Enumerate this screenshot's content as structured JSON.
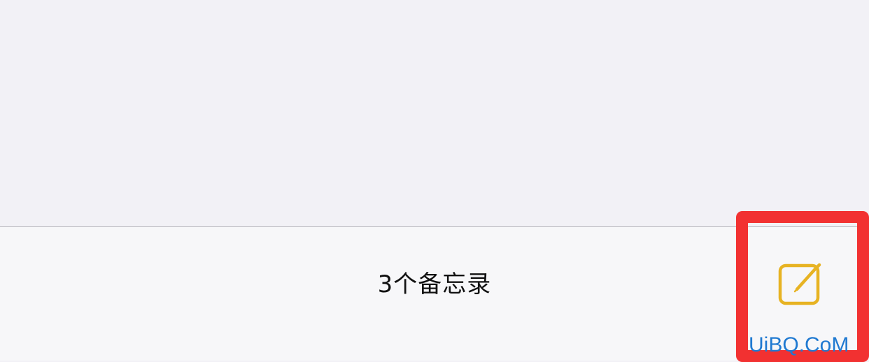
{
  "main": {
    "content_area": {}
  },
  "toolbar": {
    "note_count_label": "3个备忘录",
    "compose_icon": "square-and-pencil-icon",
    "accent_color": "#e7b323"
  },
  "annotation": {
    "highlight_color": "#f23131"
  },
  "watermark": {
    "text": "UiBQ.CoM",
    "color": "#1f79d1"
  }
}
